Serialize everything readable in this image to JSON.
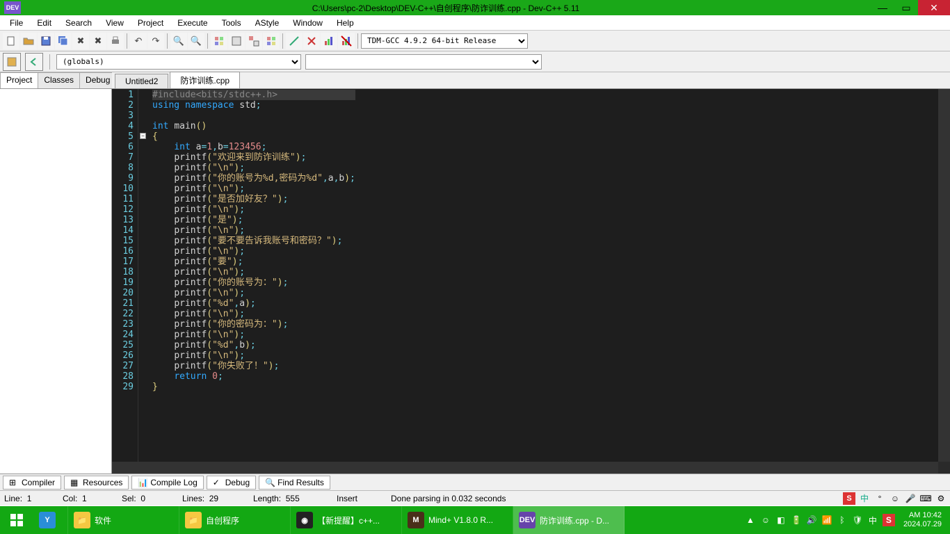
{
  "title": "C:\\Users\\pc-2\\Desktop\\DEV-C++\\自创程序\\防诈训练.cpp - Dev-C++ 5.11",
  "menu": [
    "File",
    "Edit",
    "Search",
    "View",
    "Project",
    "Execute",
    "Tools",
    "AStyle",
    "Window",
    "Help"
  ],
  "compiler_select": "TDM-GCC 4.9.2 64-bit Release",
  "scope_select": "(globals)",
  "sidebar_tabs": [
    "Project",
    "Classes",
    "Debug"
  ],
  "editor_tabs": [
    "Untitled2",
    "防诈训练.cpp"
  ],
  "code": {
    "lines": [
      {
        "n": 1,
        "hl": true,
        "tokens": [
          [
            "k-pp",
            "#include"
          ],
          [
            "k-inc",
            "<bits/stdc++.h>"
          ]
        ]
      },
      {
        "n": 2,
        "tokens": [
          [
            "k-kw",
            "using"
          ],
          [
            "",
            " "
          ],
          [
            "k-kw",
            "namespace"
          ],
          [
            "",
            " "
          ],
          [
            "k-id",
            "std"
          ],
          [
            "k-punc",
            ";"
          ]
        ]
      },
      {
        "n": 3,
        "tokens": [
          [
            "",
            ""
          ]
        ]
      },
      {
        "n": 4,
        "tokens": [
          [
            "k-type",
            "int"
          ],
          [
            "",
            " "
          ],
          [
            "k-fn",
            "main"
          ],
          [
            "k-br",
            "()"
          ]
        ]
      },
      {
        "n": 5,
        "fold": true,
        "tokens": [
          [
            "k-br",
            "{"
          ]
        ]
      },
      {
        "n": 6,
        "tokens": [
          [
            "",
            "    "
          ],
          [
            "k-type",
            "int"
          ],
          [
            "",
            " "
          ],
          [
            "k-id",
            "a"
          ],
          [
            "k-punc",
            "="
          ],
          [
            "k-num",
            "1"
          ],
          [
            "k-punc",
            ","
          ],
          [
            "k-id",
            "b"
          ],
          [
            "k-punc",
            "="
          ],
          [
            "k-num",
            "123456"
          ],
          [
            "k-punc",
            ";"
          ]
        ]
      },
      {
        "n": 7,
        "tokens": [
          [
            "",
            "    "
          ],
          [
            "k-fn",
            "printf"
          ],
          [
            "k-br",
            "("
          ],
          [
            "k-str",
            "\"欢迎来到防诈训练\""
          ],
          [
            "k-br",
            ")"
          ],
          [
            "k-punc",
            ";"
          ]
        ]
      },
      {
        "n": 8,
        "tokens": [
          [
            "",
            "    "
          ],
          [
            "k-fn",
            "printf"
          ],
          [
            "k-br",
            "("
          ],
          [
            "k-str",
            "\"\\n\""
          ],
          [
            "k-br",
            ")"
          ],
          [
            "k-punc",
            ";"
          ]
        ]
      },
      {
        "n": 9,
        "tokens": [
          [
            "",
            "    "
          ],
          [
            "k-fn",
            "printf"
          ],
          [
            "k-br",
            "("
          ],
          [
            "k-str",
            "\"你的账号为%d,密码为%d\""
          ],
          [
            "k-punc",
            ","
          ],
          [
            "k-id",
            "a"
          ],
          [
            "k-punc",
            ","
          ],
          [
            "k-id",
            "b"
          ],
          [
            "k-br",
            ")"
          ],
          [
            "k-punc",
            ";"
          ]
        ]
      },
      {
        "n": 10,
        "tokens": [
          [
            "",
            "    "
          ],
          [
            "k-fn",
            "printf"
          ],
          [
            "k-br",
            "("
          ],
          [
            "k-str",
            "\"\\n\""
          ],
          [
            "k-br",
            ")"
          ],
          [
            "k-punc",
            ";"
          ]
        ]
      },
      {
        "n": 11,
        "tokens": [
          [
            "",
            "    "
          ],
          [
            "k-fn",
            "printf"
          ],
          [
            "k-br",
            "("
          ],
          [
            "k-str",
            "\"是否加好友？\""
          ],
          [
            "k-br",
            ")"
          ],
          [
            "k-punc",
            ";"
          ]
        ]
      },
      {
        "n": 12,
        "tokens": [
          [
            "",
            "    "
          ],
          [
            "k-fn",
            "printf"
          ],
          [
            "k-br",
            "("
          ],
          [
            "k-str",
            "\"\\n\""
          ],
          [
            "k-br",
            ")"
          ],
          [
            "k-punc",
            ";"
          ]
        ]
      },
      {
        "n": 13,
        "tokens": [
          [
            "",
            "    "
          ],
          [
            "k-fn",
            "printf"
          ],
          [
            "k-br",
            "("
          ],
          [
            "k-str",
            "\"是\""
          ],
          [
            "k-br",
            ")"
          ],
          [
            "k-punc",
            ";"
          ]
        ]
      },
      {
        "n": 14,
        "tokens": [
          [
            "",
            "    "
          ],
          [
            "k-fn",
            "printf"
          ],
          [
            "k-br",
            "("
          ],
          [
            "k-str",
            "\"\\n\""
          ],
          [
            "k-br",
            ")"
          ],
          [
            "k-punc",
            ";"
          ]
        ]
      },
      {
        "n": 15,
        "tokens": [
          [
            "",
            "    "
          ],
          [
            "k-fn",
            "printf"
          ],
          [
            "k-br",
            "("
          ],
          [
            "k-str",
            "\"要不要告诉我账号和密码？\""
          ],
          [
            "k-br",
            ")"
          ],
          [
            "k-punc",
            ";"
          ]
        ]
      },
      {
        "n": 16,
        "tokens": [
          [
            "",
            "    "
          ],
          [
            "k-fn",
            "printf"
          ],
          [
            "k-br",
            "("
          ],
          [
            "k-str",
            "\"\\n\""
          ],
          [
            "k-br",
            ")"
          ],
          [
            "k-punc",
            ";"
          ]
        ]
      },
      {
        "n": 17,
        "tokens": [
          [
            "",
            "    "
          ],
          [
            "k-fn",
            "printf"
          ],
          [
            "k-br",
            "("
          ],
          [
            "k-str",
            "\"要\""
          ],
          [
            "k-br",
            ")"
          ],
          [
            "k-punc",
            ";"
          ]
        ]
      },
      {
        "n": 18,
        "tokens": [
          [
            "",
            "    "
          ],
          [
            "k-fn",
            "printf"
          ],
          [
            "k-br",
            "("
          ],
          [
            "k-str",
            "\"\\n\""
          ],
          [
            "k-br",
            ")"
          ],
          [
            "k-punc",
            ";"
          ]
        ]
      },
      {
        "n": 19,
        "tokens": [
          [
            "",
            "    "
          ],
          [
            "k-fn",
            "printf"
          ],
          [
            "k-br",
            "("
          ],
          [
            "k-str",
            "\"你的账号为：\""
          ],
          [
            "k-br",
            ")"
          ],
          [
            "k-punc",
            ";"
          ]
        ]
      },
      {
        "n": 20,
        "tokens": [
          [
            "",
            "    "
          ],
          [
            "k-fn",
            "printf"
          ],
          [
            "k-br",
            "("
          ],
          [
            "k-str",
            "\"\\n\""
          ],
          [
            "k-br",
            ")"
          ],
          [
            "k-punc",
            ";"
          ]
        ]
      },
      {
        "n": 21,
        "tokens": [
          [
            "",
            "    "
          ],
          [
            "k-fn",
            "printf"
          ],
          [
            "k-br",
            "("
          ],
          [
            "k-str",
            "\"%d\""
          ],
          [
            "k-punc",
            ","
          ],
          [
            "k-id",
            "a"
          ],
          [
            "k-br",
            ")"
          ],
          [
            "k-punc",
            ";"
          ]
        ]
      },
      {
        "n": 22,
        "tokens": [
          [
            "",
            "    "
          ],
          [
            "k-fn",
            "printf"
          ],
          [
            "k-br",
            "("
          ],
          [
            "k-str",
            "\"\\n\""
          ],
          [
            "k-br",
            ")"
          ],
          [
            "k-punc",
            ";"
          ]
        ]
      },
      {
        "n": 23,
        "tokens": [
          [
            "",
            "    "
          ],
          [
            "k-fn",
            "printf"
          ],
          [
            "k-br",
            "("
          ],
          [
            "k-str",
            "\"你的密码为：\""
          ],
          [
            "k-br",
            ")"
          ],
          [
            "k-punc",
            ";"
          ]
        ]
      },
      {
        "n": 24,
        "tokens": [
          [
            "",
            "    "
          ],
          [
            "k-fn",
            "printf"
          ],
          [
            "k-br",
            "("
          ],
          [
            "k-str",
            "\"\\n\""
          ],
          [
            "k-br",
            ")"
          ],
          [
            "k-punc",
            ";"
          ]
        ]
      },
      {
        "n": 25,
        "tokens": [
          [
            "",
            "    "
          ],
          [
            "k-fn",
            "printf"
          ],
          [
            "k-br",
            "("
          ],
          [
            "k-str",
            "\"%d\""
          ],
          [
            "k-punc",
            ","
          ],
          [
            "k-id",
            "b"
          ],
          [
            "k-br",
            ")"
          ],
          [
            "k-punc",
            ";"
          ]
        ]
      },
      {
        "n": 26,
        "tokens": [
          [
            "",
            "    "
          ],
          [
            "k-fn",
            "printf"
          ],
          [
            "k-br",
            "("
          ],
          [
            "k-str",
            "\"\\n\""
          ],
          [
            "k-br",
            ")"
          ],
          [
            "k-punc",
            ";"
          ]
        ]
      },
      {
        "n": 27,
        "tokens": [
          [
            "",
            "    "
          ],
          [
            "k-fn",
            "printf"
          ],
          [
            "k-br",
            "("
          ],
          [
            "k-str",
            "\"你失败了！\""
          ],
          [
            "k-br",
            ")"
          ],
          [
            "k-punc",
            ";"
          ]
        ]
      },
      {
        "n": 28,
        "tokens": [
          [
            "",
            "    "
          ],
          [
            "k-kw",
            "return"
          ],
          [
            "",
            " "
          ],
          [
            "k-num",
            "0"
          ],
          [
            "k-punc",
            ";"
          ]
        ]
      },
      {
        "n": 29,
        "tokens": [
          [
            "k-br",
            "}"
          ]
        ]
      }
    ]
  },
  "bottom_tabs": [
    "Compiler",
    "Resources",
    "Compile Log",
    "Debug",
    "Find Results"
  ],
  "status": {
    "line_label": "Line:",
    "line": "1",
    "col_label": "Col:",
    "col": "1",
    "sel_label": "Sel:",
    "sel": "0",
    "lines_label": "Lines:",
    "lines": "29",
    "length_label": "Length:",
    "length": "555",
    "mode": "Insert",
    "msg": "Done parsing in 0.032 seconds"
  },
  "taskbar": {
    "items": [
      {
        "label": "",
        "icon": "Y",
        "bg": "#2a8ed8"
      },
      {
        "label": "软件",
        "icon": "📁",
        "bg": "#f5c842"
      },
      {
        "label": "自创程序",
        "icon": "📁",
        "bg": "#f5c842"
      },
      {
        "label": "【新提醒】c++...",
        "icon": "◉",
        "bg": "#222"
      },
      {
        "label": "Mind+ V1.8.0 R...",
        "icon": "M",
        "bg": "#4a2f1a"
      },
      {
        "label": "防诈训练.cpp - D...",
        "icon": "DEV",
        "bg": "#6644aa",
        "active": true
      }
    ],
    "clock_time": "AM 10:42",
    "clock_date": "2024.07.29",
    "ime": "中"
  }
}
